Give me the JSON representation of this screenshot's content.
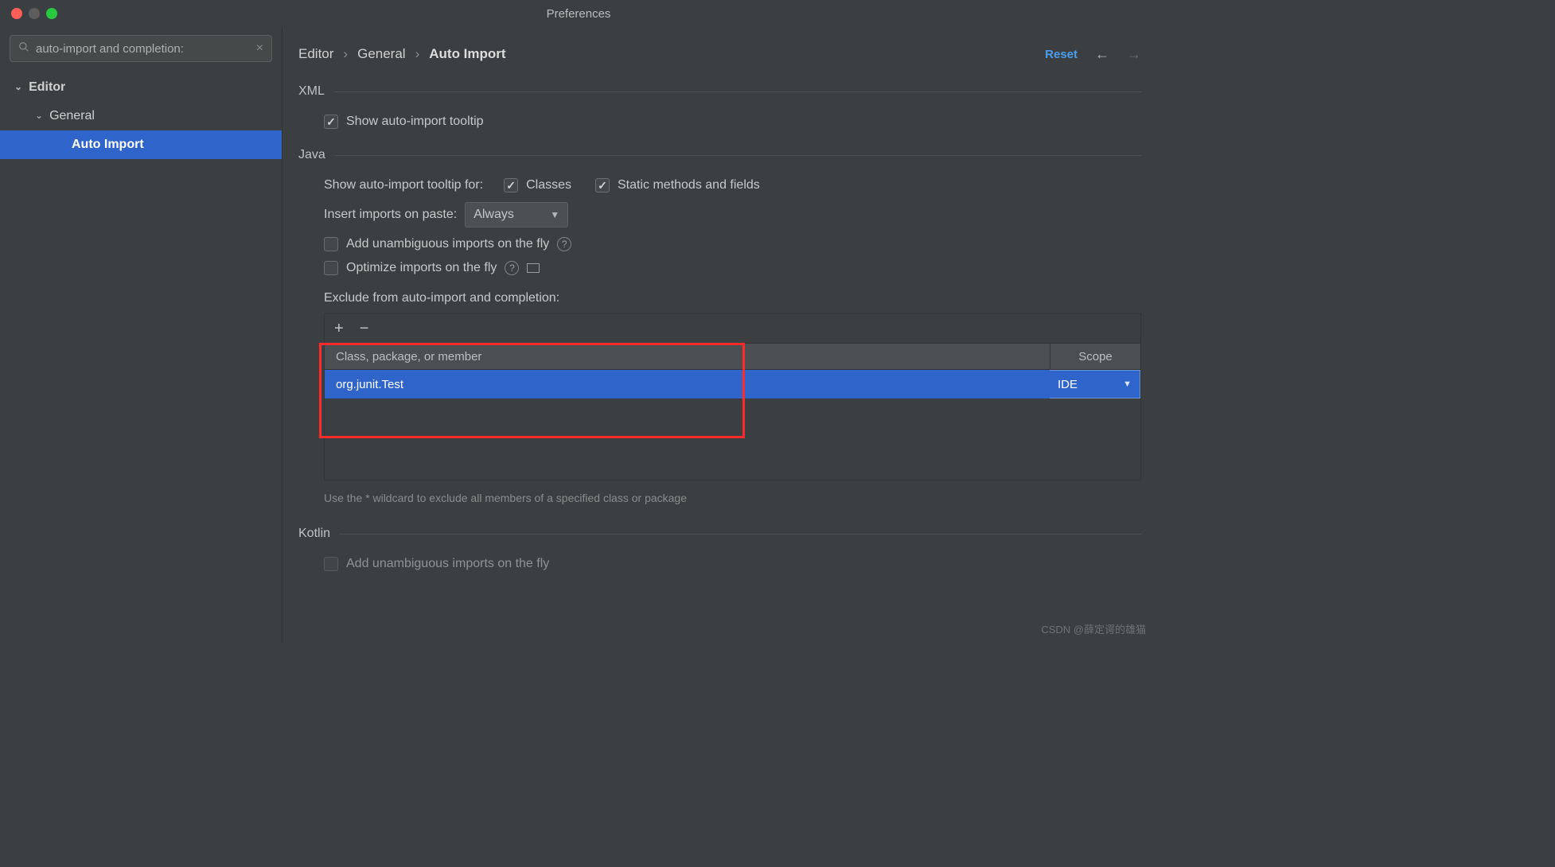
{
  "window": {
    "title": "Preferences"
  },
  "search": {
    "text": "auto-import and completion:"
  },
  "sidebar": {
    "items": [
      {
        "label": "Editor"
      },
      {
        "label": "General"
      },
      {
        "label": "Auto Import"
      }
    ]
  },
  "header": {
    "crumbs": [
      "Editor",
      "General",
      "Auto Import"
    ],
    "reset_label": "Reset"
  },
  "xml": {
    "title": "XML",
    "show_tooltip_label": "Show auto-import tooltip",
    "show_tooltip_checked": true
  },
  "java": {
    "title": "Java",
    "tooltip_for_label": "Show auto-import tooltip for:",
    "classes_label": "Classes",
    "classes_checked": true,
    "static_label": "Static methods and fields",
    "static_checked": true,
    "insert_paste_label": "Insert imports on paste:",
    "insert_paste_value": "Always",
    "add_unambiguous_label": "Add unambiguous imports on the fly",
    "add_unambiguous_checked": false,
    "optimize_label": "Optimize imports on the fly",
    "optimize_checked": false,
    "exclude_label": "Exclude from auto-import and completion:",
    "table": {
      "header_class": "Class, package, or member",
      "header_scope": "Scope",
      "rows": [
        {
          "class": "org.junit.Test",
          "scope": "IDE"
        }
      ]
    },
    "hint": "Use the * wildcard to exclude all members of a specified class or package"
  },
  "kotlin": {
    "title": "Kotlin",
    "add_unambiguous_label": "Add unambiguous imports on the fly",
    "add_unambiguous_checked": false
  },
  "watermark": "CSDN @薛定谔的雄猫"
}
